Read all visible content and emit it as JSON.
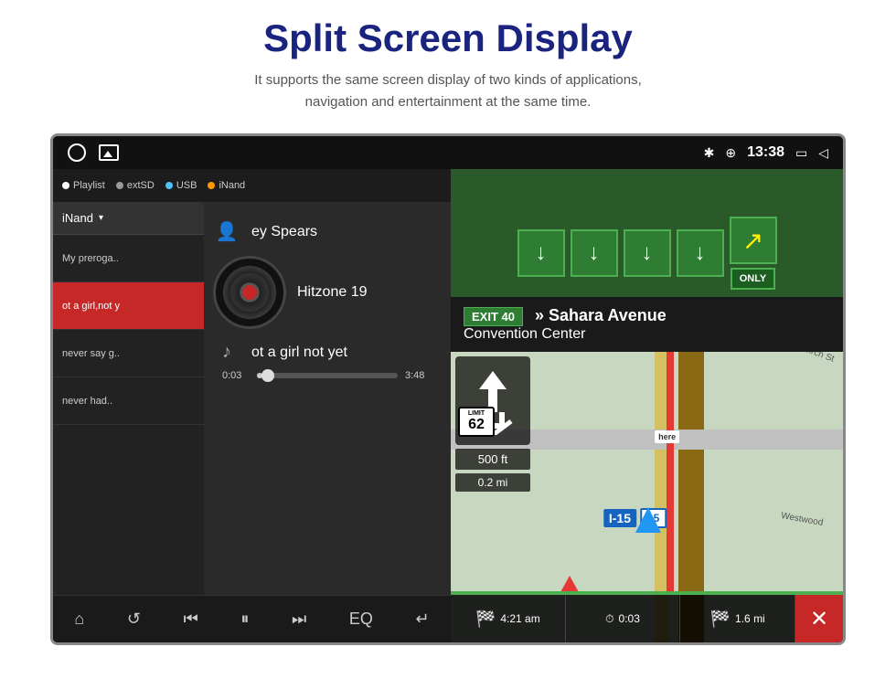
{
  "page": {
    "title": "Split Screen Display",
    "subtitle_line1": "It supports the same screen display of two kinds of applications,",
    "subtitle_line2": "navigation and entertainment at the same time."
  },
  "status_bar": {
    "time": "13:38",
    "bluetooth_icon": "✱",
    "location_icon": "⊕",
    "window_icon": "▭",
    "back_icon": "◁"
  },
  "music_player": {
    "source_playlist": "Playlist",
    "source_extsd": "extSD",
    "source_usb": "USB",
    "source_inand": "iNand",
    "playlist_title": "iNand",
    "songs": [
      {
        "label": "My preroga..",
        "active": false
      },
      {
        "label": "ot a girl,not y",
        "active": true
      },
      {
        "label": "never say g..",
        "active": false
      },
      {
        "label": "never had..",
        "active": false
      }
    ],
    "artist": "ey Spears",
    "album": "Hitzone 19",
    "track": "ot a girl not yet",
    "time_current": "0:03",
    "time_total": "3:48",
    "controls": {
      "home": "⌂",
      "repeat": "↺",
      "prev": "⏮",
      "pause": "⏸",
      "next": "⏭",
      "eq": "EQ",
      "back": "↵"
    }
  },
  "navigation": {
    "exit_number": "EXIT 40",
    "exit_name": "» Sahara Avenue",
    "exit_subname": "Convention Center",
    "highway_name": "I-15",
    "highway_number": "15",
    "speed_limit": "62",
    "distance_turn": "0.2 mi",
    "distance_500ft": "500 ft",
    "road_birch": "Birch St",
    "road_west": "Westwood",
    "bottom_time": "4:21 am",
    "bottom_elapsed": "0:03",
    "bottom_distance": "1.6 mi",
    "only_label": "ONLY",
    "close_btn": "✕"
  }
}
